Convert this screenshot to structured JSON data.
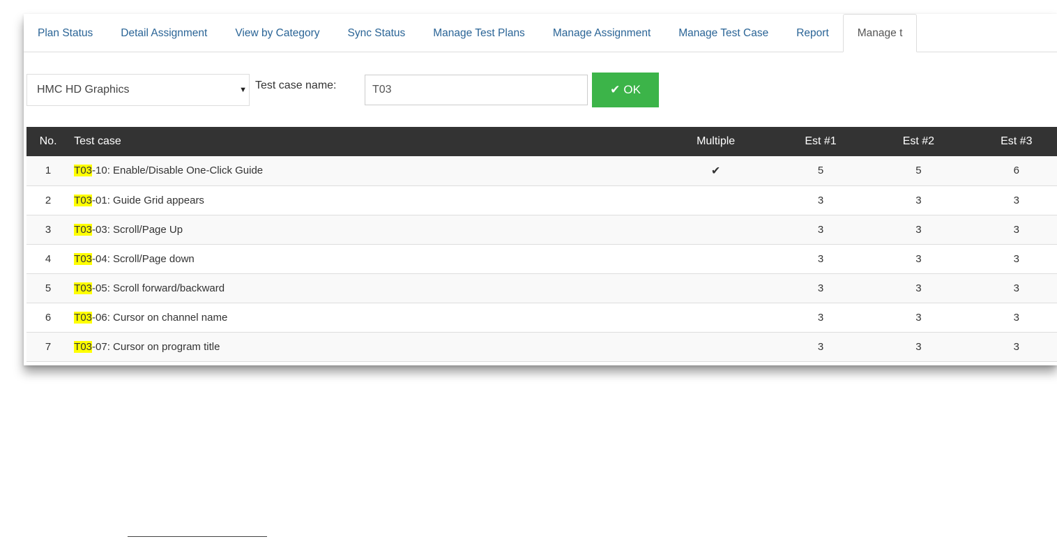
{
  "tabs": [
    {
      "label": "Plan Status"
    },
    {
      "label": "Detail Assignment"
    },
    {
      "label": "View by Category"
    },
    {
      "label": "Sync Status"
    },
    {
      "label": "Manage Test Plans"
    },
    {
      "label": "Manage Assignment"
    },
    {
      "label": "Manage Test Case"
    },
    {
      "label": "Report"
    },
    {
      "label": "Manage t"
    }
  ],
  "toolbar": {
    "select_value": "HMC HD Graphics",
    "test_case_label": "Test case name:",
    "search_value": "T03",
    "ok_label": "OK"
  },
  "table": {
    "headers": [
      "No.",
      "Test case",
      "Multiple",
      "Est #1",
      "Est #2",
      "Est #3"
    ],
    "rows": [
      {
        "no": "1",
        "prefix": "T03",
        "rest": "-10: Enable/Disable One-Click Guide",
        "multiple": true,
        "est1": "5",
        "est2": "5",
        "est3": "6"
      },
      {
        "no": "2",
        "prefix": "T03",
        "rest": "-01: Guide Grid appears",
        "multiple": false,
        "est1": "3",
        "est2": "3",
        "est3": "3"
      },
      {
        "no": "3",
        "prefix": "T03",
        "rest": "-03: Scroll/Page Up",
        "multiple": false,
        "est1": "3",
        "est2": "3",
        "est3": "3"
      },
      {
        "no": "4",
        "prefix": "T03",
        "rest": "-04: Scroll/Page down",
        "multiple": false,
        "est1": "3",
        "est2": "3",
        "est3": "3"
      },
      {
        "no": "5",
        "prefix": "T03",
        "rest": "-05: Scroll forward/backward",
        "multiple": false,
        "est1": "3",
        "est2": "3",
        "est3": "3"
      },
      {
        "no": "6",
        "prefix": "T03",
        "rest": "-06: Cursor on channel name",
        "multiple": false,
        "est1": "3",
        "est2": "3",
        "est3": "3"
      },
      {
        "no": "7",
        "prefix": "T03",
        "rest": "-07: Cursor on program title",
        "multiple": false,
        "est1": "3",
        "est2": "3",
        "est3": "3"
      }
    ]
  },
  "colors": {
    "link": "#2a6496",
    "ok_button": "#3cb449",
    "header_bg": "#333333",
    "highlight": "#ffff00"
  }
}
